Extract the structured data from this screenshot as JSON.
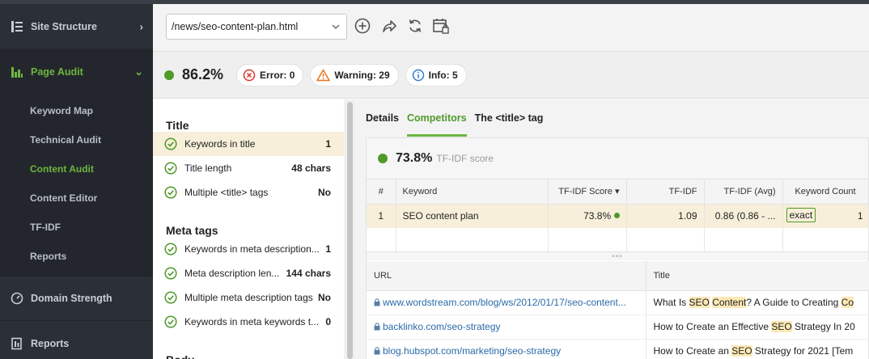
{
  "sidebar": {
    "sections": [
      {
        "label": "Site Structure",
        "icon": "site-structure-icon",
        "chevron": "›"
      },
      {
        "label": "Page Audit",
        "icon": "page-audit-icon",
        "chevron": "⌄"
      },
      {
        "label": "Domain Strength",
        "icon": "gauge-icon"
      },
      {
        "label": "Reports",
        "icon": "reports-icon"
      }
    ],
    "sub_items": [
      {
        "label": "Keyword Map"
      },
      {
        "label": "Technical Audit"
      },
      {
        "label": "Content Audit"
      },
      {
        "label": "Content Editor"
      },
      {
        "label": "TF-IDF"
      },
      {
        "label": "Reports"
      }
    ]
  },
  "toolbar": {
    "url_value": "/news/seo-content-plan.html",
    "icons": [
      "add-icon",
      "share-icon",
      "refresh-icon",
      "schedule-icon"
    ]
  },
  "scorebar": {
    "score": "86.2%",
    "error": "Error: 0",
    "warning": "Warning: 29",
    "info": "Info: 5"
  },
  "checklist": {
    "title_section": {
      "heading": "Title",
      "rows": [
        {
          "label": "Keywords in title",
          "value": "1"
        },
        {
          "label": "Title length",
          "value": "48 chars"
        },
        {
          "label": "Multiple <title> tags",
          "value": "No"
        }
      ]
    },
    "meta_section": {
      "heading": "Meta tags",
      "rows": [
        {
          "label": "Keywords in meta description...",
          "value": "1"
        },
        {
          "label": "Meta description len...",
          "value": "144 chars"
        },
        {
          "label": "Multiple meta description tags",
          "value": "No"
        },
        {
          "label": "Keywords in meta keywords t...",
          "value": "0"
        }
      ]
    },
    "body_section": {
      "heading": "Body"
    }
  },
  "tabs": [
    "Details",
    "Competitors",
    "The <title> tag"
  ],
  "tfidf": {
    "score": "73.8%",
    "label": "TF-IDF score",
    "columns": [
      "#",
      "Keyword",
      "TF-IDF Score ▾",
      "TF-IDF",
      "TF-IDF (Avg)",
      "Keyword Count"
    ],
    "rows": [
      {
        "num": "1",
        "keyword": "SEO content plan",
        "score": "73.8%",
        "tfidf": "1.09",
        "avg": "0.86 (0.86 - ...",
        "match": "exact",
        "count": "1"
      }
    ]
  },
  "competitors": {
    "columns": [
      "URL",
      "Title"
    ],
    "rows": [
      {
        "url": "www.wordstream.com/blog/ws/2012/01/17/seo-content...",
        "title_parts": [
          "What Is ",
          "SEO",
          " ",
          "Content",
          "? A Guide to Creating ",
          "Co"
        ]
      },
      {
        "url": "backlinko.com/seo-strategy",
        "title_parts": [
          "How to Create an Effective ",
          "SEO",
          " Strategy In 20"
        ]
      },
      {
        "url": "blog.hubspot.com/marketing/seo-strategy",
        "title_parts": [
          "How to Create an ",
          "SEO",
          " Strategy for 2021 [Tem"
        ]
      }
    ]
  },
  "colors": {
    "sidebar_bg": "#2b3037",
    "accent_green": "#6fb43f",
    "score_green": "#4f9a2a",
    "error_red": "#d9342b",
    "warning_orange": "#e8731c",
    "info_blue": "#2f7fcf",
    "link_blue": "#2a6aa8",
    "highlight": "#fde9b6"
  }
}
